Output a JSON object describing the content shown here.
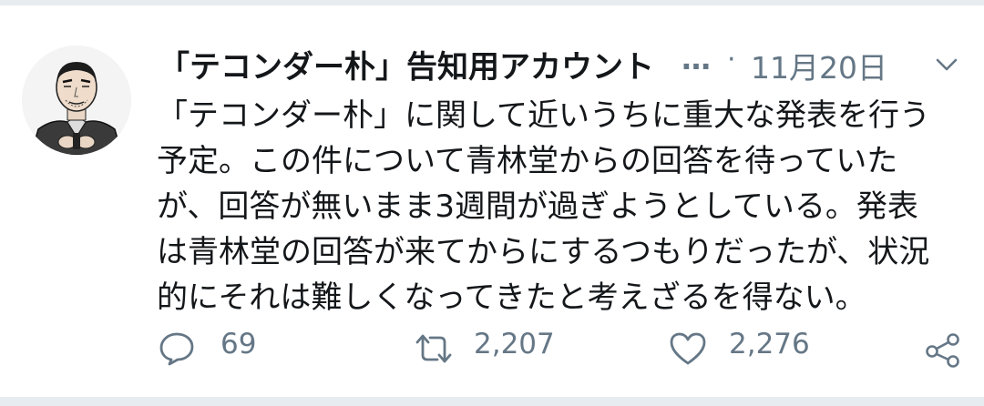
{
  "tweet": {
    "display_name": "「テコンダー朴」告知用アカウント",
    "ellipsis": "…",
    "separator": "·",
    "date": "11月20日",
    "body_lines": [
      "「テコンダー朴」に関して近いうちに重大な発表を行う",
      "予定。この件について青林堂からの回答を待っていた",
      "が、回答が無いまま3週間が過ぎようとしている。発表",
      "は青林堂の回答が来てからにするつもりだったが、状況",
      "的にそれは難しくなってきたと考えざるを得ない。"
    ],
    "actions": {
      "reply_count": "69",
      "retweet_count": "2,207",
      "like_count": "2,276"
    }
  },
  "icons": {
    "reply": "speech-bubble-icon",
    "retweet": "retweet-arrows-icon",
    "like": "heart-icon",
    "share": "share-icon",
    "menu": "chevron-down-icon"
  },
  "colors": {
    "text": "#14171a",
    "secondary": "#657786",
    "background": "#ffffff",
    "page": "#e6ecf0"
  }
}
